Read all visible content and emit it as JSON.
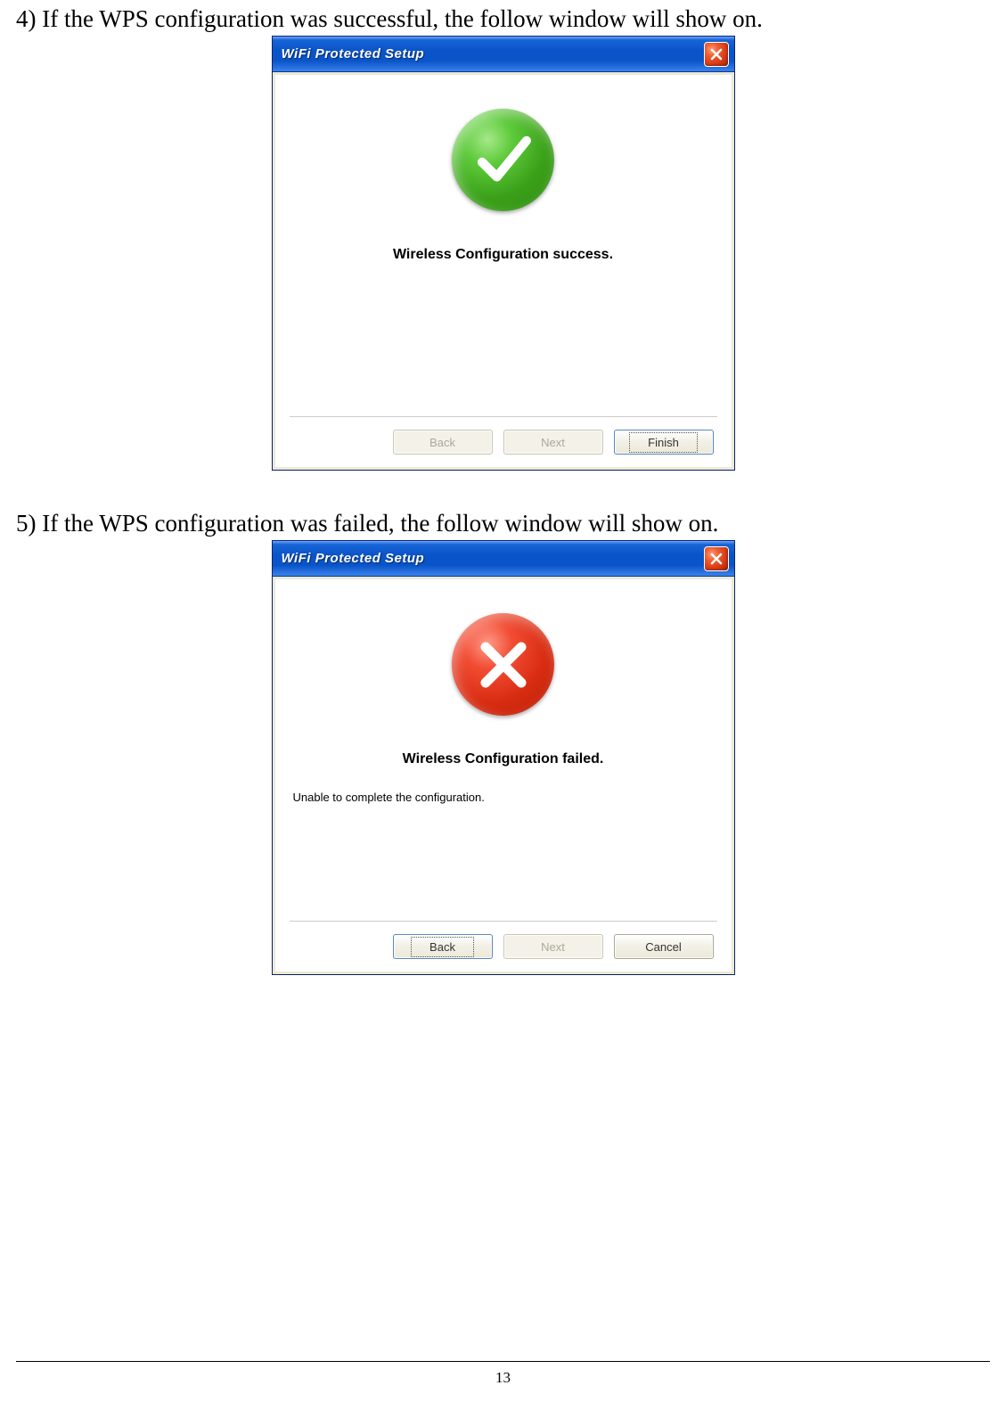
{
  "step4_text": "4) If the WPS configuration was successful, the follow window will show on.",
  "step5_text": "5) If the WPS configuration was failed, the follow window will show on.",
  "page_number": "13",
  "dialog1": {
    "title": "WiFi Protected Setup",
    "message": "Wireless Configuration success.",
    "buttons": {
      "back": "Back",
      "next": "Next",
      "finish": "Finish"
    }
  },
  "dialog2": {
    "title": "WiFi Protected Setup",
    "message": "Wireless Configuration failed.",
    "detail": "Unable to complete the configuration.",
    "buttons": {
      "back": "Back",
      "next": "Next",
      "cancel": "Cancel"
    }
  }
}
